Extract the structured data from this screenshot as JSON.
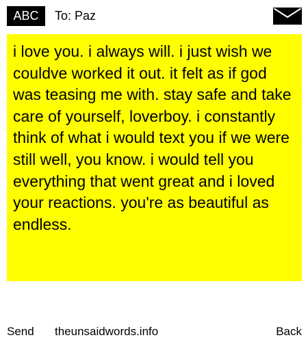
{
  "header": {
    "badge": "ABC",
    "to_label": "To:",
    "recipient": "Paz",
    "icon": "envelope-icon"
  },
  "message": {
    "text": "i love you. i always will. i just wish we couldve worked it out. it felt as if god was teasing me with. stay safe and take care of yourself, loverboy. i constantly think of what i would text you if we were still well, you know. i would tell you everything that went great and i loved your reactions. you're as beautiful as endless."
  },
  "footer": {
    "send_label": "Send",
    "site_label": "theunsaidwords.info",
    "back_label": "Back"
  },
  "colors": {
    "message_background": "#ffff00",
    "badge_background": "#000000",
    "badge_text": "#ffffff"
  }
}
